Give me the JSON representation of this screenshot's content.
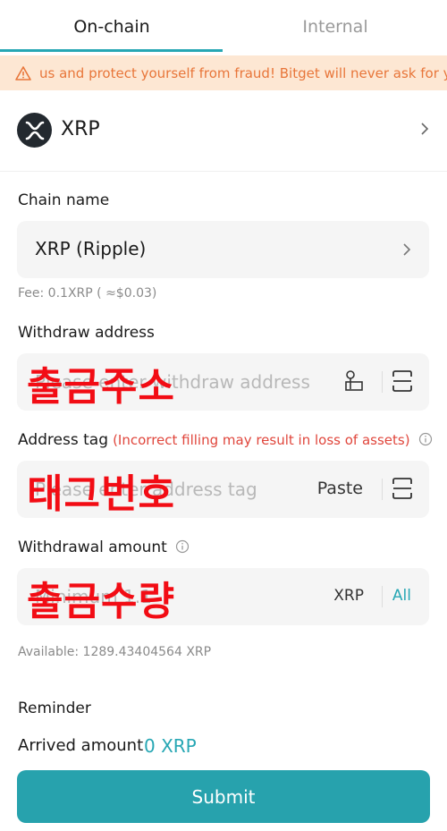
{
  "tabs": [
    {
      "label": "On-chain",
      "active": true
    },
    {
      "label": "Internal",
      "active": false
    }
  ],
  "banner": {
    "icon": "warning-icon",
    "text": "us and protect yourself from fraud! Bitget will never ask for your"
  },
  "coin": {
    "name": "XRP",
    "icon": "xrp-logo-icon"
  },
  "chain": {
    "label": "Chain name",
    "value": "XRP (Ripple)",
    "fee": "Fee: 0.1XRP ( ≈$0.03)"
  },
  "address": {
    "label": "Withdraw address",
    "placeholder": "Please enter withdraw address",
    "overlay": "출금주소"
  },
  "tag": {
    "label": "Address tag",
    "warning": "(Incorrect filling may result in loss of assets)",
    "placeholder": "Please enter address tag",
    "paste": "Paste",
    "overlay": "태그번호"
  },
  "amount": {
    "label": "Withdrawal amount",
    "placeholder": "Minimum 1.1",
    "unit": "XRP",
    "all": "All",
    "overlay": "출금수량",
    "available": "Available: 1289.43404564 XRP"
  },
  "reminder": {
    "label": "Reminder"
  },
  "arrived": {
    "label": "Arrived amount",
    "value": "0 XRP"
  },
  "submit": {
    "label": "Submit"
  },
  "colors": {
    "accent": "#27a7b4",
    "warning_bg": "#fde7d3",
    "warning_text": "#e8763a",
    "error": "#e0463c",
    "overlay_red": "#f20c14"
  }
}
